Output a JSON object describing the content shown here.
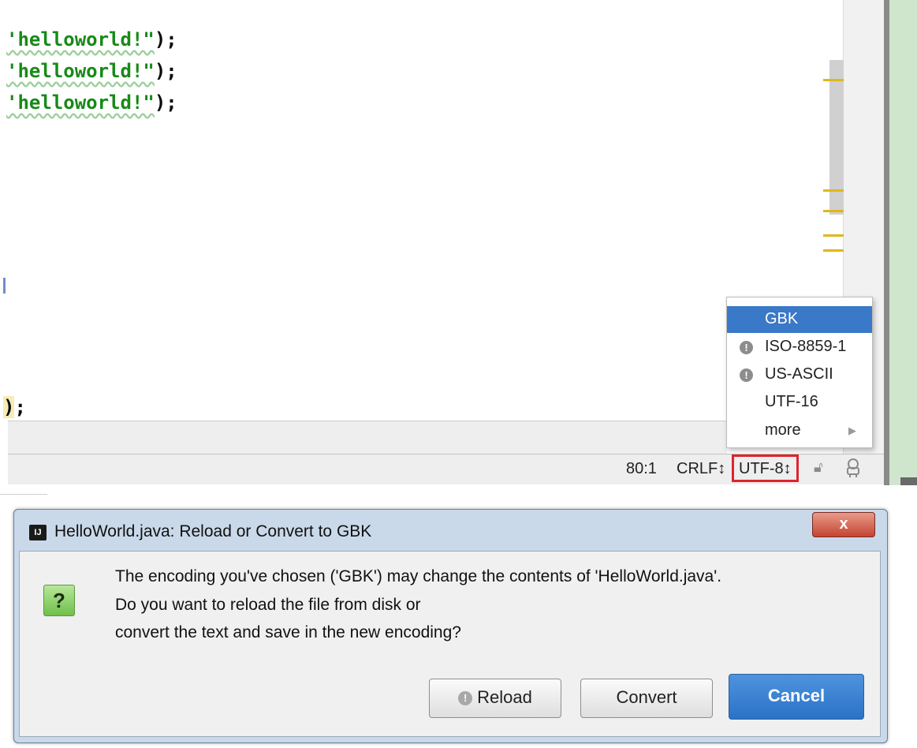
{
  "editor": {
    "lines": [
      {
        "str": "'helloworld!\"",
        "tail": ");"
      },
      {
        "str": "'helloworld!\"",
        "tail": ");"
      },
      {
        "str": "'helloworld!\"",
        "tail": ");"
      }
    ],
    "close_paren": ")",
    "close_tail": ";"
  },
  "status_bar": {
    "position": "80:1",
    "line_separator": "CRLF↕",
    "encoding": "UTF-8↕",
    "icons": [
      "lock-icon",
      "inspector-icon"
    ]
  },
  "encoding_menu": {
    "items": [
      {
        "label": "GBK",
        "selected": true,
        "warning": false
      },
      {
        "label": "ISO-8859-1",
        "selected": false,
        "warning": true
      },
      {
        "label": "US-ASCII",
        "selected": false,
        "warning": true
      },
      {
        "label": "UTF-16",
        "selected": false,
        "warning": false
      },
      {
        "label": "more",
        "selected": false,
        "warning": false,
        "submenu": true
      }
    ]
  },
  "dialog": {
    "app_icon": "IJ",
    "title": "HelloWorld.java: Reload or Convert to GBK",
    "close_label": "x",
    "question_icon": "?",
    "message_lines": [
      "The encoding you've chosen ('GBK') may change the contents of 'HelloWorld.java'.",
      "Do you want to reload the file from disk or",
      "convert the text and save in the new encoding?"
    ],
    "buttons": {
      "reload": "Reload",
      "convert": "Convert",
      "cancel": "Cancel"
    }
  },
  "colors": {
    "string_green": "#178a17",
    "selection_blue": "#3a78c8",
    "highlight_red": "#e0232b",
    "cancel_blue": "#2b72c7",
    "dialog_frame": "#c9d9ea"
  }
}
